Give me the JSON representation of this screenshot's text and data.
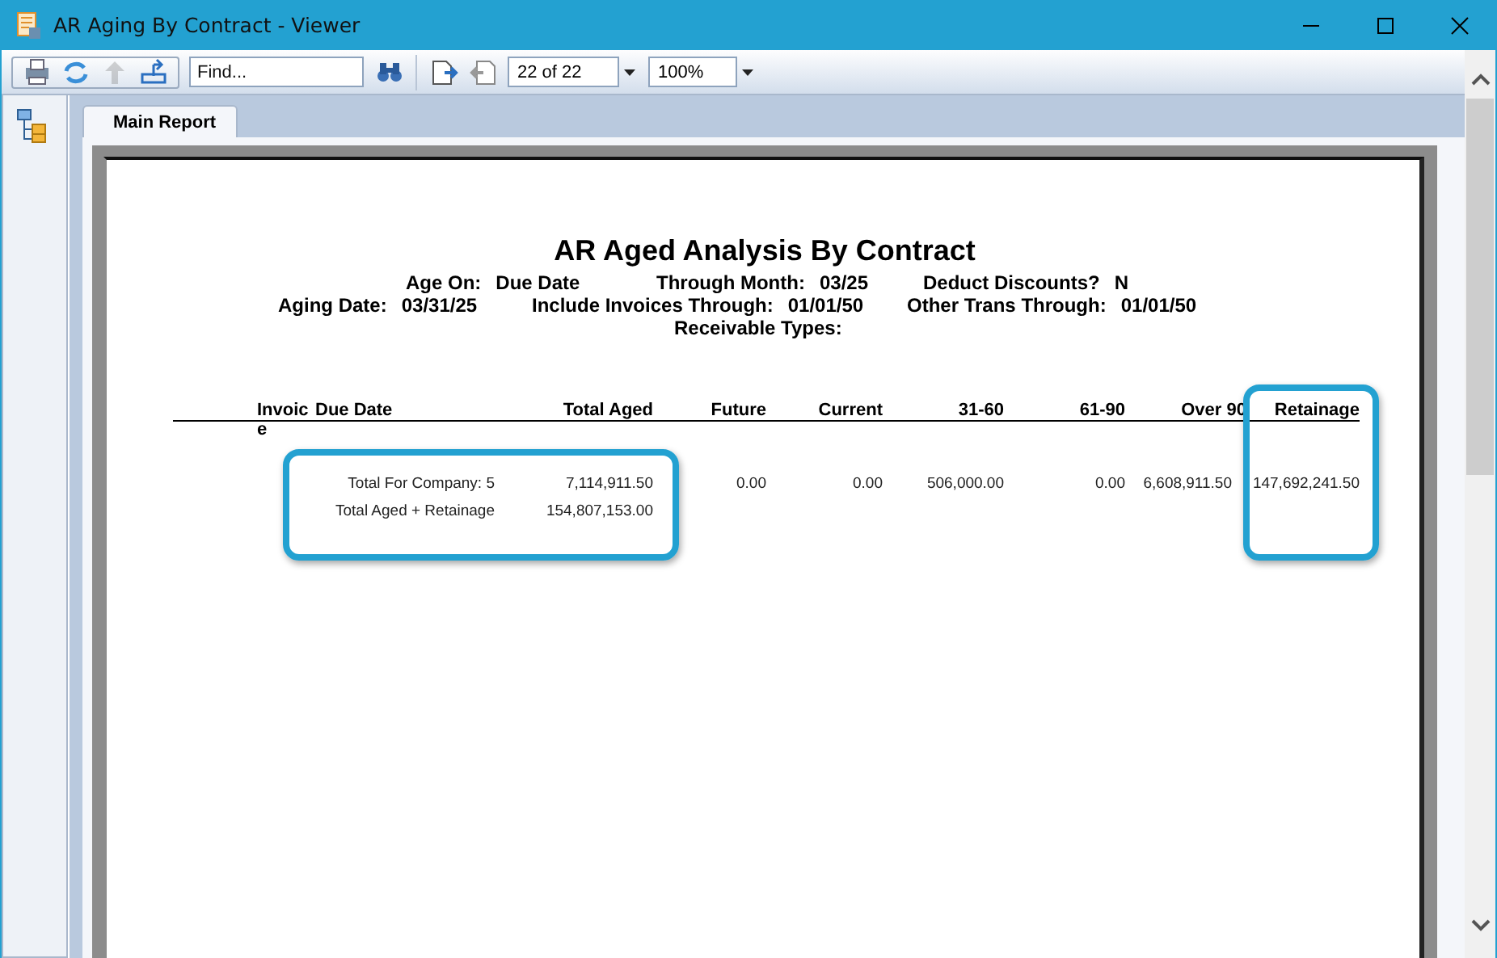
{
  "window": {
    "title": "AR Aging By Contract - Viewer"
  },
  "toolbar": {
    "buttons": [
      {
        "kind": "print",
        "disabled": false
      },
      {
        "kind": "refresh",
        "disabled": false
      },
      {
        "kind": "up",
        "disabled": true
      },
      {
        "kind": "export",
        "disabled": false
      }
    ],
    "find": {
      "placeholder": "Find..."
    },
    "page": "22 of 22",
    "zoom": "100%"
  },
  "tabs": [
    {
      "label": "Main Report",
      "selected": true
    }
  ],
  "report": {
    "title": "AR Aged Analysis By Contract",
    "parameters": [
      [
        {
          "label": "Age On:",
          "value": "Due Date"
        },
        {
          "label": "Through Month:",
          "value": "03/25"
        },
        {
          "label": "Deduct Discounts?",
          "value": "N"
        }
      ],
      [
        {
          "label": "Aging Date:",
          "value": "03/31/25"
        },
        {
          "label": "Include Invoices Through:",
          "value": "01/01/50"
        },
        {
          "label": "Other Trans Through:",
          "value": "01/01/50"
        }
      ],
      [
        {
          "label": "Receivable Types:"
        }
      ]
    ],
    "columns": [
      {
        "label": "Invoice",
        "highlighted": false
      },
      {
        "label": "Due Date",
        "highlighted": false
      },
      {
        "label": "Total Aged",
        "highlighted": false
      },
      {
        "label": "Future",
        "highlighted": false
      },
      {
        "label": "Current",
        "highlighted": false
      },
      {
        "label": "31-60",
        "highlighted": false
      },
      {
        "label": "61-90",
        "highlighted": false
      },
      {
        "label": "Over 90",
        "highlighted": false
      },
      {
        "label": "Retainage",
        "highlighted": true
      }
    ],
    "rows": [
      {
        "label": "Total For Company: 5",
        "values": [
          "7,114,911.50",
          "0.00",
          "0.00",
          "506,000.00",
          "0.00",
          "6,608,911.50",
          "147,692,241.50"
        ],
        "highlighted": true
      },
      {
        "label": "Total Aged + Retainage",
        "values": [
          "154,807,153.00"
        ],
        "highlighted": true
      }
    ]
  }
}
